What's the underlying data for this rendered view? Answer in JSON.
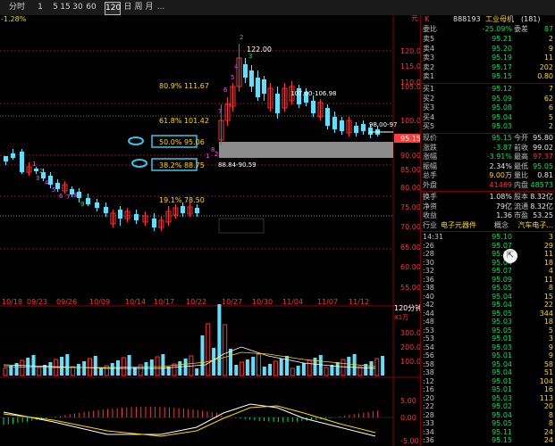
{
  "toolbar": {
    "items": [
      {
        "label": "分时"
      },
      {
        "label": "1"
      },
      {
        "label": "5"
      },
      {
        "label": "15"
      },
      {
        "label": "30"
      },
      {
        "label": "60"
      },
      {
        "label": "120"
      },
      {
        "label": "日"
      },
      {
        "label": "周"
      },
      {
        "label": "月"
      },
      {
        "label": "..."
      }
    ],
    "active": "120"
  },
  "chart": {
    "header_change": "-1.28%",
    "right_unit": "元",
    "period_label": "120分钟",
    "vol_label": "X1万",
    "y_ticks": [
      "120.00",
      "115.00",
      "110.00",
      "105.00",
      "100.00",
      "90.00",
      "85.00",
      "80.00",
      "75.00",
      "70.00",
      "65.00",
      "60.00",
      "55.00"
    ],
    "x_ticks": [
      "10/18",
      "09/23",
      "09/26",
      "10/09",
      "10/14",
      "10/17",
      "10/22",
      "10/27",
      "10/30",
      "11/04",
      "11/07",
      "11/12"
    ],
    "vol_ticks": [
      "300.00",
      "200.00",
      "100.00"
    ],
    "macd_ticks": [
      "5.00",
      "0.00",
      "-5.00"
    ],
    "current_price": "95.15",
    "annotations": {
      "peak": "122.00",
      "range_high": "107.00-106.98",
      "range_low": "88.84-90.59",
      "right_mark": "98.00-97",
      "fib_80": "80.9% 111.67",
      "fib_61": "61.8% 101.42",
      "fib_50": "50.0% 95.06",
      "fib_38": "38.2% 88.75",
      "fib_19": "19.1% 78.50",
      "wave_numbers": [
        "1",
        "2",
        "3",
        "4",
        "5",
        "6",
        "7",
        "8",
        "9",
        "2",
        "3",
        "4",
        "5",
        "6",
        "7",
        "8",
        "1",
        "2"
      ]
    }
  },
  "right_panel": {
    "header": {
      "prefix": "K",
      "code": "888193",
      "name": "工业母机",
      "extra": "(181)"
    },
    "ratio": {
      "label": "委比",
      "value": "-25.09%",
      "label2": "委差",
      "value2": "87"
    },
    "asks": [
      {
        "label": "卖5",
        "price": "95.21",
        "vol": "2"
      },
      {
        "label": "卖4",
        "price": "95.20",
        "vol": "9"
      },
      {
        "label": "卖3",
        "price": "95.19",
        "vol": "11"
      },
      {
        "label": "卖2",
        "price": "95.17",
        "vol": "202"
      },
      {
        "label": "卖1",
        "price": "95.15",
        "vol": "0.80"
      }
    ],
    "bids": [
      {
        "label": "买1",
        "price": "95.12",
        "vol": "7"
      },
      {
        "label": "买2",
        "price": "95.09",
        "vol": "62"
      },
      {
        "label": "买3",
        "price": "95.08",
        "vol": "6"
      },
      {
        "label": "买4",
        "price": "95.04",
        "vol": "5"
      },
      {
        "label": "买5",
        "price": "95.03",
        "vol": "2"
      }
    ],
    "stats": [
      {
        "l1": "现价",
        "v1": "95.15",
        "l2": "今开",
        "v2": "95.80"
      },
      {
        "l1": "涨跌",
        "v1": "-3.87",
        "l2": "前收",
        "v2": "99.02"
      },
      {
        "l1": "涨幅",
        "v1": "-3.91%",
        "l2": "最高",
        "v2": "97.37"
      },
      {
        "l1": "振幅",
        "v1": "2.34%",
        "l2": "最低",
        "v2": "95.05"
      },
      {
        "l1": "总手",
        "v1": "9.00万",
        "l2": "量比",
        "v2": "0.81"
      },
      {
        "l1": "外盘",
        "v1": "41469",
        "l2": "内盘",
        "v2": "48573"
      }
    ],
    "stats2": [
      {
        "l1": "换手",
        "v1": "1.08%",
        "l2": "股本",
        "v2": "8.32亿"
      },
      {
        "l1": "净资",
        "v1": "79亿",
        "l2": "流通",
        "v2": "8.32亿"
      },
      {
        "l1": "收益",
        "v1": "1.36",
        "l2": "市盈",
        "v2": "53.25"
      }
    ],
    "industry": {
      "l1": "行业",
      "v1": "电子元器件",
      "v2": "概念",
      "v3": "汽车电子..."
    },
    "ticks": [
      {
        "t": "14:31",
        "p": "95.10",
        "v": "3"
      },
      {
        "t": ":26",
        "p": "95.07",
        "v": "29"
      },
      {
        "t": ":28",
        "p": "95.04",
        "v": "11"
      },
      {
        "t": ":30",
        "p": "95.04",
        "v": "18"
      },
      {
        "t": ":32",
        "p": "95.07",
        "v": "4"
      },
      {
        "t": ":36",
        "p": "95.09",
        "v": "11"
      },
      {
        "t": ":38",
        "p": "95.05",
        "v": "8"
      },
      {
        "t": ":40",
        "p": "95.04",
        "v": "15"
      },
      {
        "t": ":42",
        "p": "95.04",
        "v": "22"
      },
      {
        "t": ":44",
        "p": "95.05",
        "v": "344"
      },
      {
        "t": ":48",
        "p": "95.03",
        "v": "18"
      },
      {
        "t": ":53",
        "p": "95.05",
        "v": "5"
      },
      {
        "t": ":53",
        "p": "95.01",
        "v": "3"
      },
      {
        "t": ":54",
        "p": "95.03",
        "v": "9"
      },
      {
        "t": ":56",
        "p": "95.01",
        "v": "9"
      },
      {
        "t": ":58",
        "p": "95.04",
        "v": "58"
      },
      {
        "t": ":38",
        "p": "95.04",
        "v": "51"
      },
      {
        "t": ":12",
        "p": "95.01",
        "v": "104"
      },
      {
        "t": ":16",
        "p": "95.01",
        "v": "16"
      },
      {
        "t": ":20",
        "p": "95.03",
        "v": "113"
      },
      {
        "t": ":22",
        "p": "95.02",
        "v": "20"
      },
      {
        "t": ":28",
        "p": "95.04",
        "v": "8"
      },
      {
        "t": ":33",
        "p": "95.05",
        "v": "8"
      },
      {
        "t": ":34",
        "p": "95.11",
        "v": "24"
      },
      {
        "t": ":36",
        "p": "95.15",
        "v": "24"
      }
    ]
  }
}
